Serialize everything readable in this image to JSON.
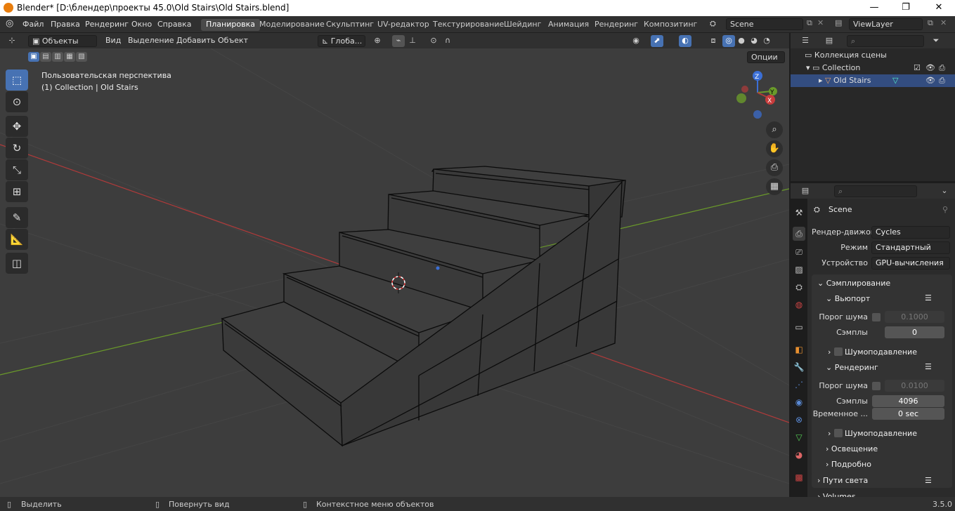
{
  "window": {
    "title": "Blender* [D:\\блендер\\проекты 45.0\\Old Stairs\\Old Stairs.blend]",
    "minimize": "—",
    "maximize": "❐",
    "close": "✕"
  },
  "menu": {
    "file": "Файл",
    "edit": "Правка",
    "render": "Рендеринг",
    "window": "Окно",
    "help": "Справка"
  },
  "workspaces": [
    "Планировка",
    "Моделирование",
    "Скульптинг",
    "UV-редактор",
    "Текстурирование",
    "Шейдинг",
    "Анимация",
    "Рендеринг",
    "Композитинг"
  ],
  "scene": {
    "name": "Scene",
    "viewlayer": "ViewLayer"
  },
  "viewport_header": {
    "mode": "Объекты",
    "view": "Вид",
    "select": "Выделение",
    "add": "Добавить",
    "object": "Объект",
    "transform": "Глоба...",
    "options": "Опции"
  },
  "viewport": {
    "perspective": "Пользовательская перспектива",
    "collection_info": "(1) Collection | Old Stairs",
    "gizmo_z": "Z",
    "gizmo_y": "Y",
    "gizmo_x": "X"
  },
  "outliner": {
    "scene_collection": "Коллекция сцены",
    "collection": "Collection",
    "object": "Old Stairs"
  },
  "properties": {
    "scene_label": "Scene",
    "render_engine_label": "Рендер-движок",
    "render_engine": "Cycles",
    "mode_label": "Режим",
    "mode": "Стандартный",
    "device_label": "Устройство",
    "device": "GPU-вычисления",
    "sampling": "Сэмплирование",
    "viewport": "Вьюпорт",
    "noise_threshold_label": "Порог шума",
    "viewport_noise_threshold": "0.1000",
    "samples_label": "Сэмплы",
    "viewport_samples": "0",
    "denoise": "Шумоподавление",
    "render": "Рендеринг",
    "render_noise_threshold": "0.0100",
    "render_samples": "4096",
    "time_limit_label": "Временное ...",
    "time_limit": "0 sec",
    "render_denoise": "Шумоподавление",
    "lights": "Освещение",
    "advanced": "Подробно",
    "light_paths": "Пути света",
    "volumes": "Volumes"
  },
  "status": {
    "select": "Выделить",
    "rotate": "Повернуть вид",
    "context": "Контекстное меню объектов",
    "version": "3.5.0"
  },
  "colors": {
    "accent": "#4772b3",
    "x_axis": "#b03a3a",
    "y_axis": "#6a9a2a",
    "z_axis": "#3b6fd6"
  }
}
